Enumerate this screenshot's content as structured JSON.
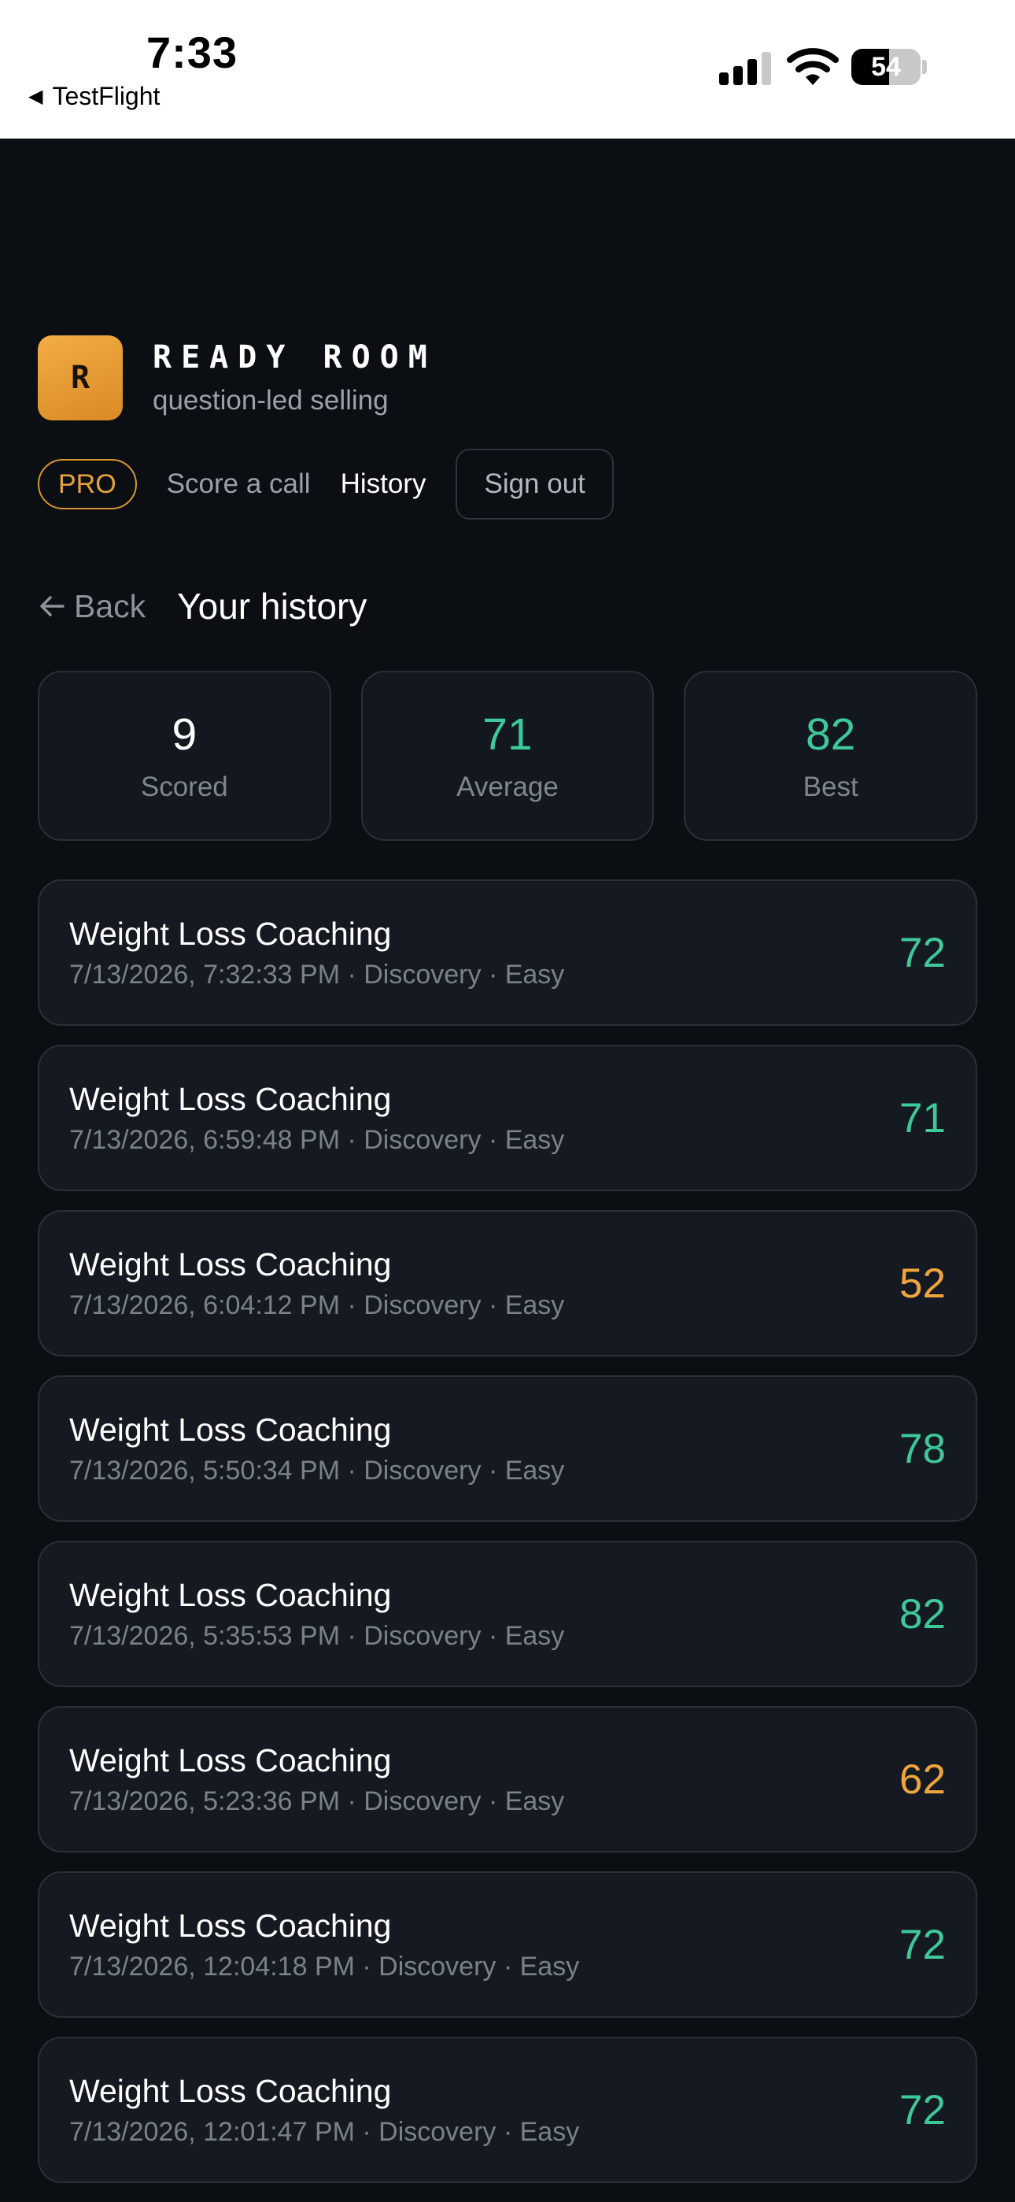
{
  "status_bar": {
    "time": "7:33",
    "back_app": "TestFlight",
    "battery": "54",
    "battery_level": 54
  },
  "brand": {
    "logo_letter": "R",
    "name": "READY ROOM",
    "tagline": "question-led selling"
  },
  "nav": {
    "badge": "PRO",
    "links": [
      "Score a call",
      "History"
    ],
    "active": "History",
    "sign_out": "Sign out"
  },
  "page": {
    "back_label": "Back",
    "title": "Your history"
  },
  "stats": [
    {
      "value": "9",
      "label": "Scored"
    },
    {
      "value": "71",
      "label": "Average"
    },
    {
      "value": "82",
      "label": "Best"
    }
  ],
  "history": [
    {
      "title": "Weight Loss Coaching",
      "meta": "7/13/2026, 7:32:33 PM · Discovery · Easy",
      "score": "72"
    },
    {
      "title": "Weight Loss Coaching",
      "meta": "7/13/2026, 6:59:48 PM · Discovery · Easy",
      "score": "71"
    },
    {
      "title": "Weight Loss Coaching",
      "meta": "7/13/2026, 6:04:12 PM · Discovery · Easy",
      "score": "52"
    },
    {
      "title": "Weight Loss Coaching",
      "meta": "7/13/2026, 5:50:34 PM · Discovery · Easy",
      "score": "78"
    },
    {
      "title": "Weight Loss Coaching",
      "meta": "7/13/2026, 5:35:53 PM · Discovery · Easy",
      "score": "82"
    },
    {
      "title": "Weight Loss Coaching",
      "meta": "7/13/2026, 5:23:36 PM · Discovery · Easy",
      "score": "62"
    },
    {
      "title": "Weight Loss Coaching",
      "meta": "7/13/2026, 12:04:18 PM · Discovery · Easy",
      "score": "72"
    },
    {
      "title": "Weight Loss Coaching",
      "meta": "7/13/2026, 12:01:47 PM · Discovery · Easy",
      "score": "72"
    }
  ],
  "colors": {
    "accent": "#e8a23c",
    "score_high": "#3ec99a",
    "score_mid": "#f0a53c",
    "background": "#0b0e13",
    "card": "#151a22"
  }
}
